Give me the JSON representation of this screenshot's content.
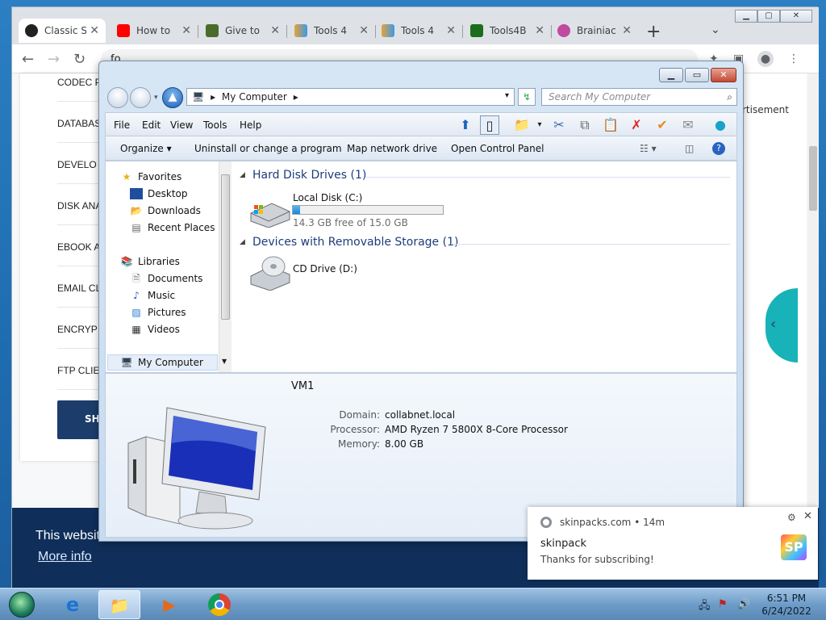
{
  "browser": {
    "tabs": [
      {
        "title": "Classic S",
        "icon": "search-favicon",
        "color": "#222222",
        "active": true
      },
      {
        "title": "How to",
        "icon": "youtube-favicon",
        "color": "#ff0000"
      },
      {
        "title": "Give to",
        "icon": "leaf-favicon",
        "color": "#4a6b2a"
      },
      {
        "title": "Tools 4",
        "icon": "rainbow-favicon",
        "color": "#e8a13a"
      },
      {
        "title": "Tools 4",
        "icon": "rainbow-favicon",
        "color": "#e8a13a"
      },
      {
        "title": "Tools4B",
        "icon": "gear-favicon",
        "color": "#3aa03a"
      },
      {
        "title": "Brainiac",
        "icon": "brain-favicon",
        "color": "#c04aa0"
      }
    ],
    "omnibox_value": "fo"
  },
  "page": {
    "categories": [
      "CODEC P",
      "DATABAS",
      "DEVELO",
      "DISK ANA",
      "EBOOK A",
      "EMAIL CL",
      "ENCRYP",
      "FTP CLIE"
    ],
    "show_button": "SHO",
    "advertisement": "rtisement",
    "cookie_text": "This websit",
    "cookie_link": "More info"
  },
  "explorer": {
    "address": "My Computer",
    "search_placeholder": "Search My Computer",
    "menu": [
      "File",
      "Edit",
      "View",
      "Tools",
      "Help"
    ],
    "commands": [
      "Organize ▾",
      "Uninstall or change a program",
      "Map network drive",
      "Open Control Panel"
    ],
    "nav": {
      "favorites": "Favorites",
      "favorites_items": [
        "Desktop",
        "Downloads",
        "Recent Places"
      ],
      "libraries": "Libraries",
      "libraries_items": [
        "Documents",
        "Music",
        "Pictures",
        "Videos"
      ],
      "computer": "My Computer"
    },
    "groups": {
      "hdd": "Hard Disk Drives (1)",
      "removable": "Devices with Removable Storage (1)"
    },
    "drives": {
      "local_name": "Local Disk (C:)",
      "local_free": "14.3 GB free of 15.0 GB",
      "local_used_fraction": 0.047,
      "cd_name": "CD Drive (D:)"
    },
    "details": {
      "name": "VM1",
      "domain_label": "Domain:",
      "domain": "collabnet.local",
      "processor_label": "Processor:",
      "processor": "AMD Ryzen 7 5800X 8-Core Processor",
      "memory_label": "Memory:",
      "memory": "8.00 GB"
    }
  },
  "notification": {
    "source": "skinpacks.com",
    "time": "14m",
    "title": "skinpack",
    "body": "Thanks for subscribing!",
    "logo": "SP"
  },
  "taskbar": {
    "time": "6:51 PM",
    "date": "6/24/2022"
  }
}
